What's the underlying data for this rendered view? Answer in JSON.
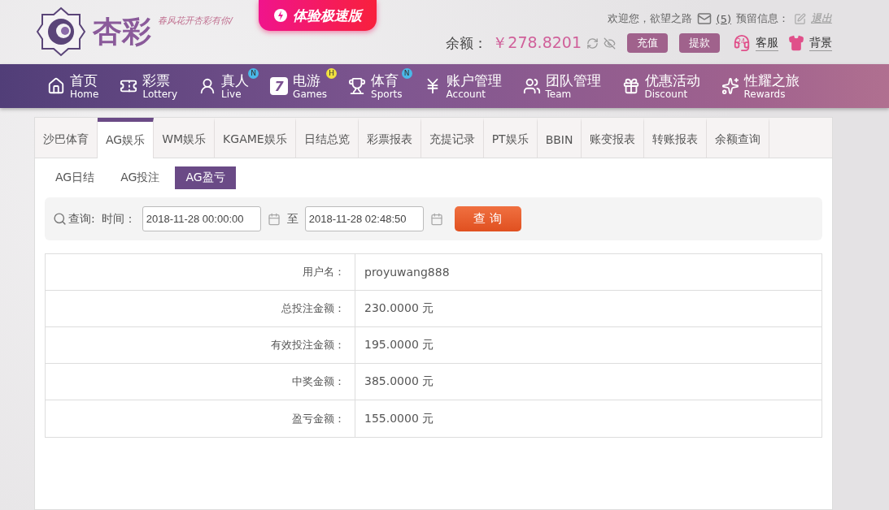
{
  "header": {
    "logo_text": "杏彩",
    "tagline": "春风花开杏彩有你/",
    "promo": "体验极速版",
    "welcome": "欢迎您，欲望之路",
    "messages": "(5)",
    "reserved_info": "预留信息：",
    "logout": "退出",
    "balance_label": "余额：",
    "balance": "￥278.8201",
    "deposit": "充值",
    "withdraw": "提款",
    "service": "客服",
    "service_badge": "24",
    "background": "背景"
  },
  "nav": [
    {
      "kind": "home",
      "zh": "首页",
      "en": "Home"
    },
    {
      "kind": "ticket",
      "zh": "彩票",
      "en": "Lottery"
    },
    {
      "kind": "live",
      "zh": "真人",
      "en": "Live",
      "badge": "N",
      "color": "#4ab8e8"
    },
    {
      "kind": "seven",
      "zh": "电游",
      "en": "Games",
      "badge": "H",
      "color": "#f0e040",
      "glyph": "7"
    },
    {
      "kind": "trophy",
      "zh": "体育",
      "en": "Sports",
      "badge": "N",
      "color": "#4ab8e8"
    },
    {
      "kind": "yen",
      "zh": "账户管理",
      "en": "Account"
    },
    {
      "kind": "team",
      "zh": "团队管理",
      "en": "Team"
    },
    {
      "kind": "gift",
      "zh": "优惠活动",
      "en": "Discount"
    },
    {
      "kind": "rewards",
      "zh": "性耀之旅",
      "en": "Rewards"
    }
  ],
  "tabs": [
    {
      "label": "沙巴体育",
      "selected": false
    },
    {
      "label": "AG娱乐",
      "selected": true
    },
    {
      "label": "WM娱乐",
      "selected": false
    },
    {
      "label": "KGAME娱乐",
      "selected": false
    },
    {
      "label": "日结总览",
      "selected": false
    },
    {
      "label": "彩票报表",
      "selected": false
    },
    {
      "label": "充提记录",
      "selected": false
    },
    {
      "label": "PT娱乐",
      "selected": false
    },
    {
      "label": "BBIN",
      "selected": false
    },
    {
      "label": "账变报表",
      "selected": false
    },
    {
      "label": "转账报表",
      "selected": false
    },
    {
      "label": "余额查询",
      "selected": false
    }
  ],
  "subtabs": [
    {
      "label": "AG日结",
      "selected": false
    },
    {
      "label": "AG投注",
      "selected": false
    },
    {
      "label": "AG盈亏",
      "selected": true
    }
  ],
  "query": {
    "label": "查询:",
    "time_label": "时间：",
    "start": "2018-11-28 00:00:00",
    "to": "至",
    "end": "2018-11-28 02:48:50",
    "button": "查 询"
  },
  "table": {
    "rows": [
      {
        "label": "用户名：",
        "value": "proyuwang888"
      },
      {
        "label": "总投注金额：",
        "value": "230.0000 元"
      },
      {
        "label": "有效投注金额：",
        "value": "195.0000 元"
      },
      {
        "label": "中奖金额：",
        "value": "385.0000 元"
      },
      {
        "label": "盈亏金额：",
        "value": "155.0000 元"
      }
    ]
  }
}
